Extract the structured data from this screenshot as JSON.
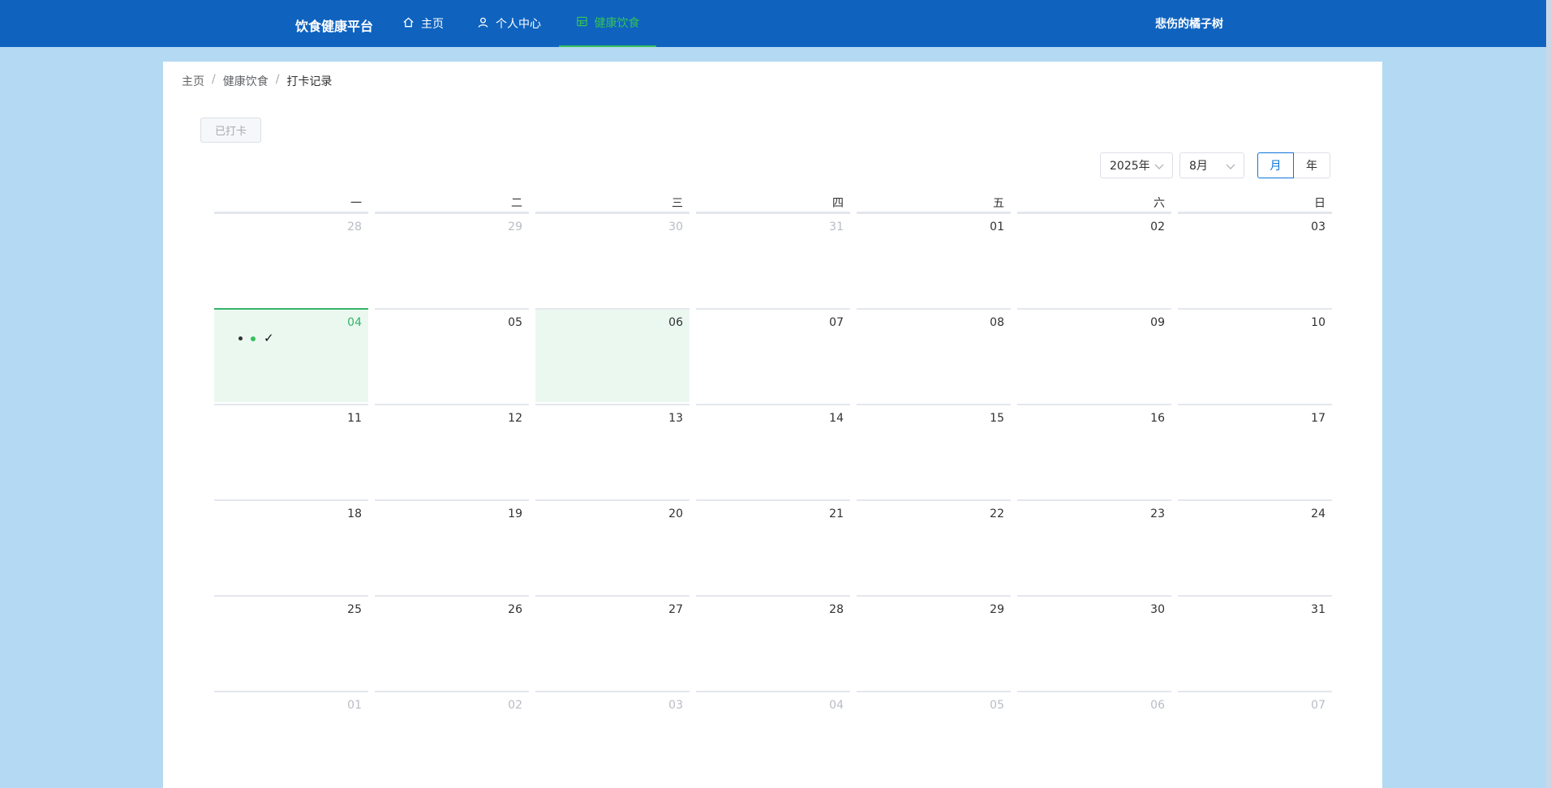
{
  "app": {
    "title": "饮食健康平台",
    "user": "悲伤的橘子树"
  },
  "nav": [
    {
      "label": "主页",
      "icon": "home-icon",
      "active": false
    },
    {
      "label": "个人中心",
      "icon": "user-icon",
      "active": true
    },
    {
      "label": "健康饮食",
      "icon": "food-icon",
      "active": true
    }
  ],
  "breadcrumb": {
    "items": [
      "主页",
      "健康饮食"
    ],
    "current": "打卡记录",
    "separator": "/"
  },
  "checkin_button": "已打卡",
  "calendar": {
    "year_select": "2025年",
    "month_select": "8月",
    "modes": [
      "月",
      "年"
    ],
    "active_mode": "月",
    "weekdays": [
      "一",
      "二",
      "三",
      "四",
      "五",
      "六",
      "日"
    ],
    "weeks": [
      [
        {
          "d": "28",
          "o": true
        },
        {
          "d": "29",
          "o": true
        },
        {
          "d": "30",
          "o": true
        },
        {
          "d": "31",
          "o": true
        },
        {
          "d": "01"
        },
        {
          "d": "02"
        },
        {
          "d": "03"
        }
      ],
      [
        {
          "d": "04",
          "today": true,
          "mark": "✓"
        },
        {
          "d": "05"
        },
        {
          "d": "06",
          "selected": true
        },
        {
          "d": "07"
        },
        {
          "d": "08"
        },
        {
          "d": "09"
        },
        {
          "d": "10"
        }
      ],
      [
        {
          "d": "11"
        },
        {
          "d": "12"
        },
        {
          "d": "13"
        },
        {
          "d": "14"
        },
        {
          "d": "15"
        },
        {
          "d": "16"
        },
        {
          "d": "17"
        }
      ],
      [
        {
          "d": "18"
        },
        {
          "d": "19"
        },
        {
          "d": "20"
        },
        {
          "d": "21"
        },
        {
          "d": "22"
        },
        {
          "d": "23"
        },
        {
          "d": "24"
        }
      ],
      [
        {
          "d": "25"
        },
        {
          "d": "26"
        },
        {
          "d": "27"
        },
        {
          "d": "28"
        },
        {
          "d": "29"
        },
        {
          "d": "30"
        },
        {
          "d": "31"
        }
      ],
      [
        {
          "d": "01",
          "o": true
        },
        {
          "d": "02",
          "o": true
        },
        {
          "d": "03",
          "o": true
        },
        {
          "d": "04",
          "o": true
        },
        {
          "d": "05",
          "o": true
        },
        {
          "d": "06",
          "o": true
        },
        {
          "d": "07",
          "o": true
        }
      ]
    ]
  },
  "colors": {
    "header": "#0f63bf",
    "background": "#b4d9f3",
    "accent": "#34c15b",
    "primary": "#0f74d8"
  }
}
